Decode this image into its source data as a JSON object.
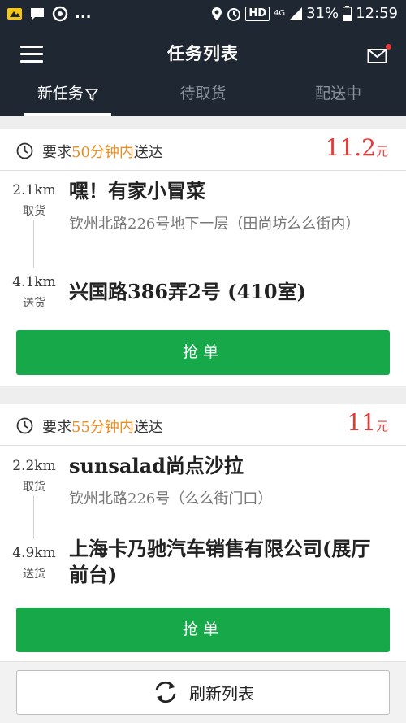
{
  "status_bar": {
    "dots": "...",
    "network": "4G",
    "battery": "31%",
    "time": "12:59",
    "hd": "HD"
  },
  "header": {
    "title": "任务列表",
    "tabs": [
      {
        "label": "新任务",
        "active": true
      },
      {
        "label": "待取货",
        "active": false
      },
      {
        "label": "配送中",
        "active": false
      }
    ]
  },
  "tasks": [
    {
      "req_prefix": "要求",
      "req_time": "50分钟内",
      "req_suffix": "送达",
      "price": "11.2",
      "currency": "元",
      "pickup": {
        "distance": "2.1km",
        "label": "取货",
        "name": "嘿！有家小冒菜",
        "address": "钦州北路226号地下一层（田尚坊么么街内）"
      },
      "delivery": {
        "distance": "4.1km",
        "label": "送货",
        "name": "兴国路386弄2号 (410室)"
      },
      "button": "抢单"
    },
    {
      "req_prefix": "要求",
      "req_time": "55分钟内",
      "req_suffix": "送达",
      "price": "11",
      "currency": "元",
      "pickup": {
        "distance": "2.2km",
        "label": "取货",
        "name": "sunsalad尚点沙拉",
        "address": "钦州北路226号（么么街门口）"
      },
      "delivery": {
        "distance": "4.9km",
        "label": "送货",
        "name": "上海卡乃驰汽车销售有限公司(展厅前台)"
      },
      "button": "抢单"
    }
  ],
  "refresh_label": "刷新列表",
  "colors": {
    "header_bg": "#1f2733",
    "accent_green": "#17a84a",
    "price_red": "#e53935",
    "highlight_orange": "#f08c1e"
  }
}
